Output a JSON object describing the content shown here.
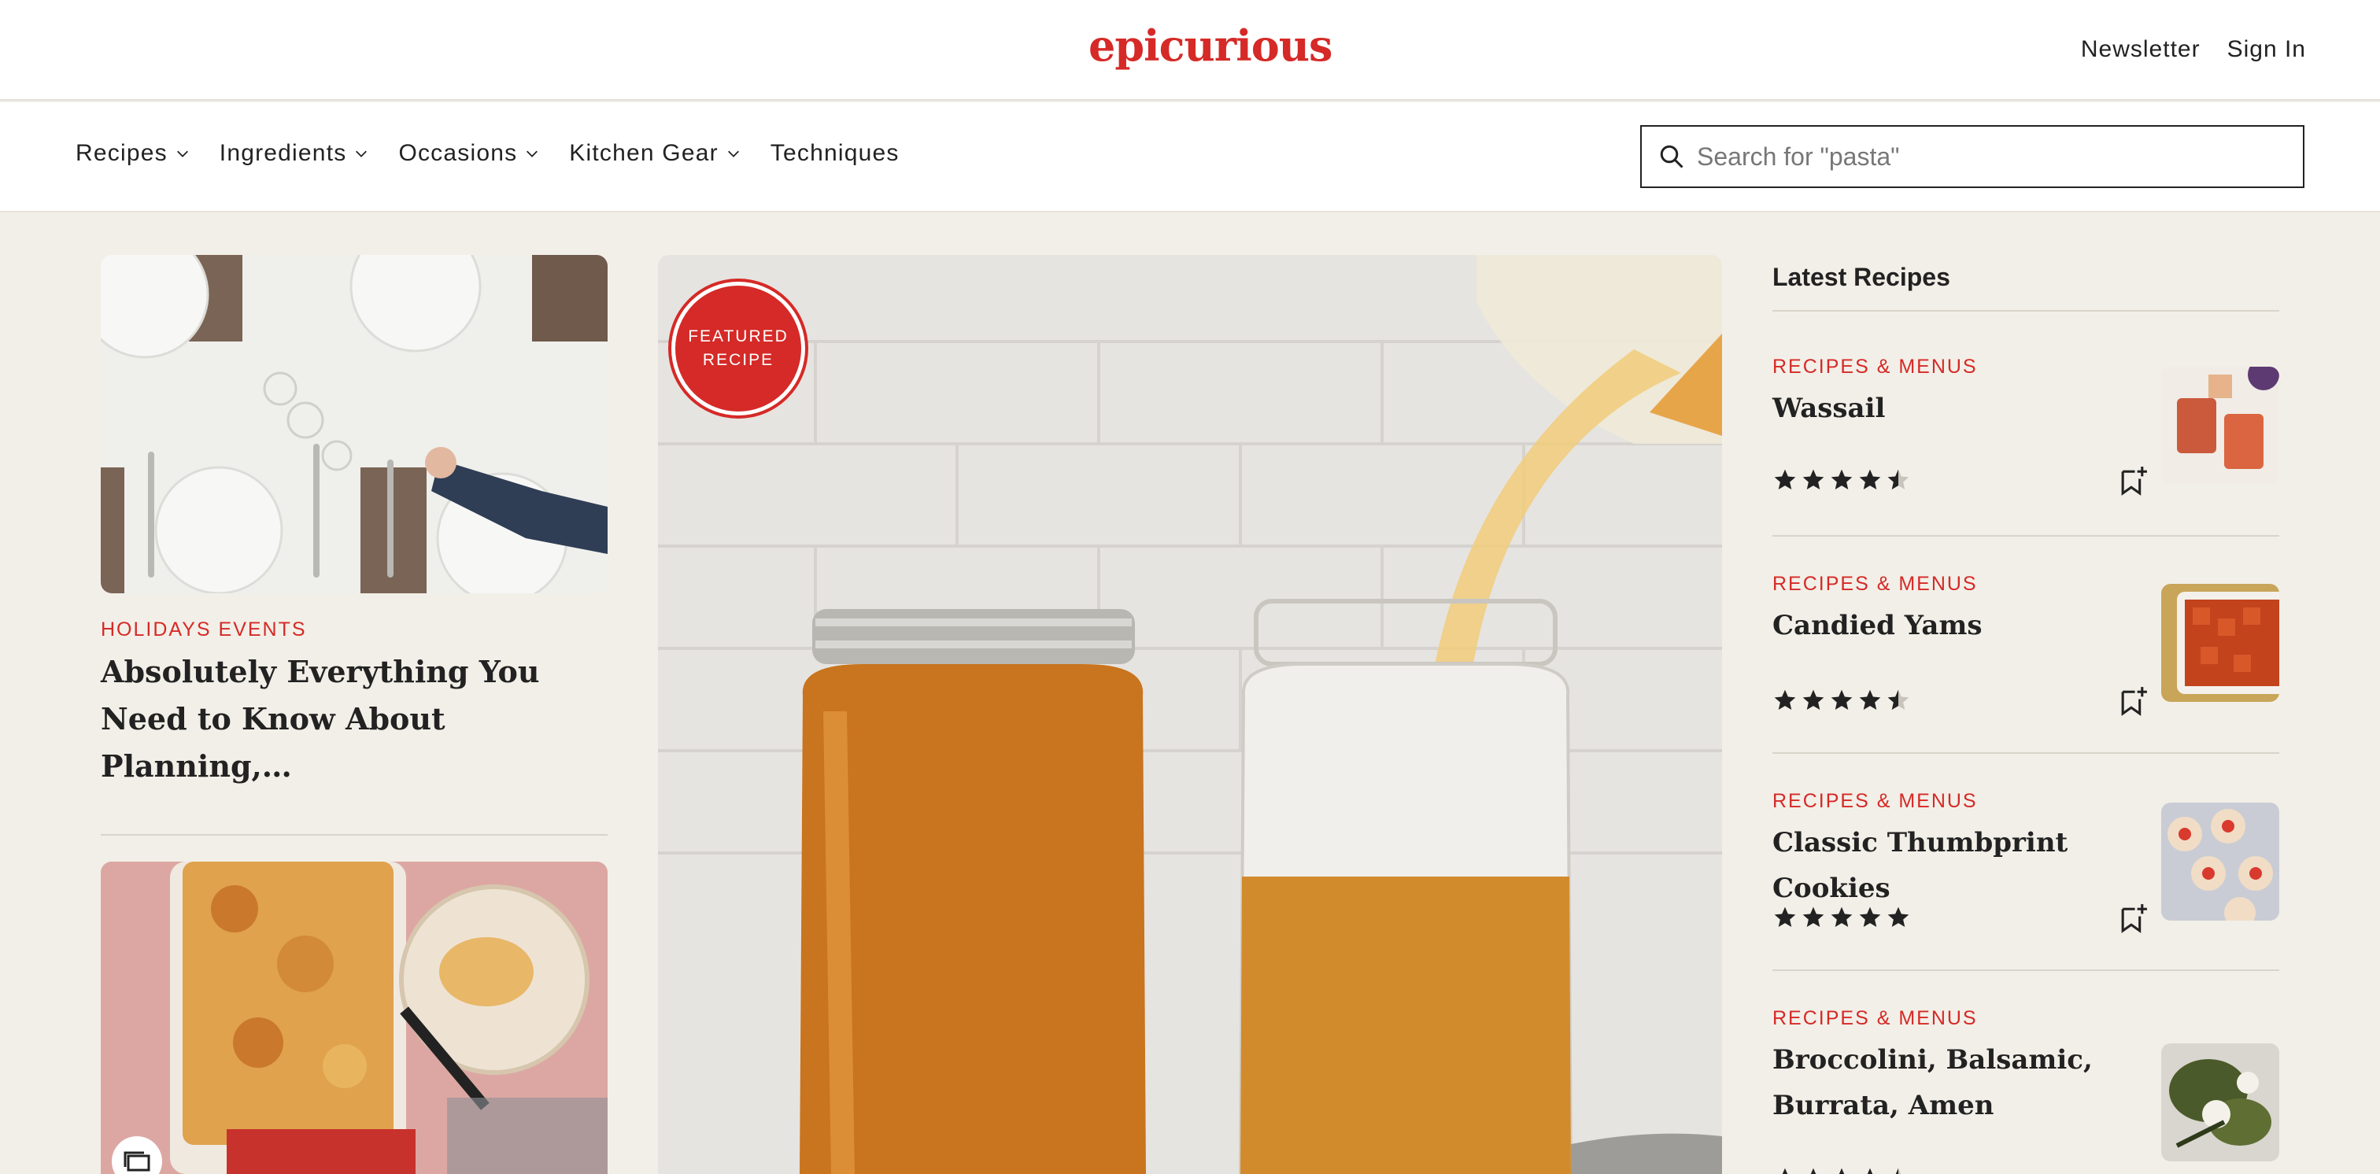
{
  "header": {
    "logo": "epicurious",
    "newsletter_label": "Newsletter",
    "signin_label": "Sign In"
  },
  "nav": {
    "items": [
      {
        "label": "Recipes",
        "has_dropdown": true
      },
      {
        "label": "Ingredients",
        "has_dropdown": true
      },
      {
        "label": "Occasions",
        "has_dropdown": true
      },
      {
        "label": "Kitchen Gear",
        "has_dropdown": true
      },
      {
        "label": "Techniques",
        "has_dropdown": false
      }
    ],
    "search_placeholder": "Search for \"pasta\""
  },
  "left_column": {
    "cards": [
      {
        "eyebrow": "HOLIDAYS EVENTS",
        "title": "Absolutely Everything You Need to Know About Planning,…",
        "image": "table-setting-photo"
      },
      {
        "image": "baked-macaroni-photo",
        "icon": "gallery-icon"
      }
    ]
  },
  "featured": {
    "badge_line1": "FEATURED",
    "badge_line2": "RECIPE",
    "image": "broth-jars-photo"
  },
  "latest": {
    "heading": "Latest Recipes",
    "items": [
      {
        "eyebrow": "RECIPES & MENUS",
        "title": "Wassail",
        "rating": 4.5,
        "thumb": "wassail-photo"
      },
      {
        "eyebrow": "RECIPES & MENUS",
        "title": "Candied Yams",
        "rating": 4.5,
        "thumb": "candied-yams-photo"
      },
      {
        "eyebrow": "RECIPES & MENUS",
        "title": "Classic Thumbprint Cookies",
        "rating": 5,
        "thumb": "thumbprint-cookies-photo"
      },
      {
        "eyebrow": "RECIPES & MENUS",
        "title": "Broccolini, Balsamic, Burrata, Amen",
        "rating": 4.5,
        "thumb": "broccolini-photo"
      }
    ]
  },
  "colors": {
    "brand_red": "#d52a27",
    "page_bg": "#f2efe8",
    "text": "#222222"
  }
}
